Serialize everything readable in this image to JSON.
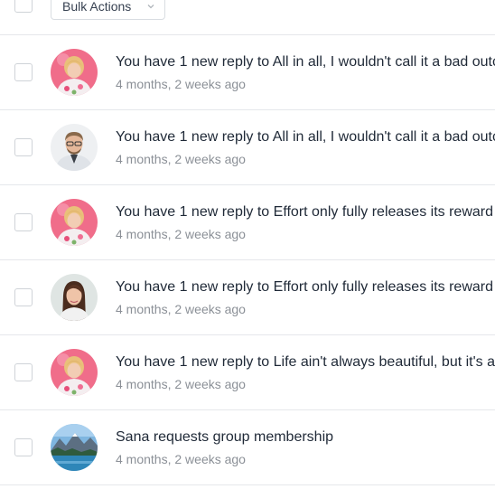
{
  "toolbar": {
    "bulk_label": "Bulk Actions"
  },
  "notifications": [
    {
      "text": "You have 1 new reply to All in all, I wouldn't call it a bad outcome",
      "time": "4 months, 2 weeks ago",
      "avatar": "woman-pink-floral-avatar"
    },
    {
      "text": "You have 1 new reply to All in all, I wouldn't call it a bad outcome",
      "time": "4 months, 2 weeks ago",
      "avatar": "man-glasses-avatar"
    },
    {
      "text": "You have 1 new reply to Effort only fully releases its reward",
      "time": "4 months, 2 weeks ago",
      "avatar": "woman-pink-floral-avatar"
    },
    {
      "text": "You have 1 new reply to Effort only fully releases its reward",
      "time": "4 months, 2 weeks ago",
      "avatar": "woman-brunette-avatar"
    },
    {
      "text": "You have 1 new reply to Life ain't always beautiful, but it's a beautiful ride",
      "time": "4 months, 2 weeks ago",
      "avatar": "woman-pink-floral-avatar"
    },
    {
      "text": "Sana requests group membership",
      "time": "4 months, 2 weeks ago",
      "avatar": "mountain-lake-group-avatar"
    }
  ]
}
